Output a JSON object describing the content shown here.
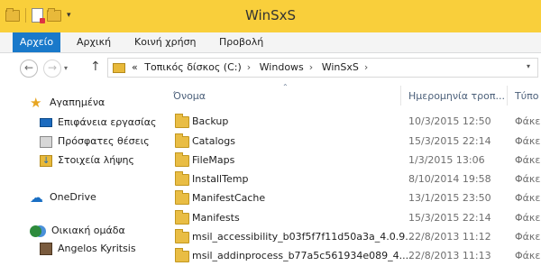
{
  "window": {
    "title": "WinSxS"
  },
  "ribbon": {
    "tabs": [
      "Αρχείο",
      "Αρχική",
      "Κοινή χρήση",
      "Προβολή"
    ]
  },
  "address": {
    "prefix": "«",
    "crumbs": [
      "Τοπικός δίσκος (C:)",
      "Windows",
      "WinSxS"
    ]
  },
  "sidebar": {
    "favorites_label": "Αγαπημένα",
    "favorites": [
      "Επιφάνεια εργασίας",
      "Πρόσφατες θέσεις",
      "Στοιχεία λήψης"
    ],
    "onedrive_label": "OneDrive",
    "homegroup_label": "Οικιακή ομάδα",
    "homegroup_user": "Angelos Kyritsis"
  },
  "columns": {
    "name": "Όνομα",
    "date": "Ημερομηνία τροπ...",
    "type": "Τύπο"
  },
  "files": [
    {
      "name": "Backup",
      "date": "10/3/2015 12:50",
      "type": "Φάκε"
    },
    {
      "name": "Catalogs",
      "date": "15/3/2015 22:14",
      "type": "Φάκε"
    },
    {
      "name": "FileMaps",
      "date": "1/3/2015 13:06",
      "type": "Φάκε"
    },
    {
      "name": "InstallTemp",
      "date": "8/10/2014 19:58",
      "type": "Φάκε"
    },
    {
      "name": "ManifestCache",
      "date": "13/1/2015 23:50",
      "type": "Φάκε"
    },
    {
      "name": "Manifests",
      "date": "15/3/2015 22:14",
      "type": "Φάκε"
    },
    {
      "name": "msil_accessibility_b03f5f7f11d50a3a_4.0.9...",
      "date": "22/8/2013 11:12",
      "type": "Φάκε"
    },
    {
      "name": "msil_addinprocess_b77a5c561934e089_4....",
      "date": "22/8/2013 11:13",
      "type": "Φάκε"
    }
  ],
  "colors": {
    "titlebar": "#f9cf3b",
    "file_tab": "#1979ca",
    "folder": "#e9bd44"
  },
  "icons": [
    "folder-icon",
    "properties-icon",
    "back-icon",
    "forward-icon",
    "up-arrow-icon",
    "star-icon",
    "desktop-icon",
    "recent-places-icon",
    "downloads-icon",
    "onedrive-cloud-icon",
    "homegroup-icon",
    "user-avatar-icon"
  ]
}
